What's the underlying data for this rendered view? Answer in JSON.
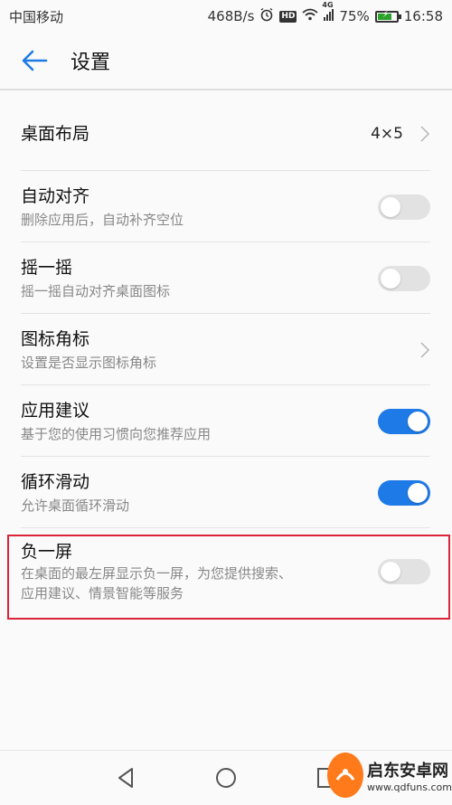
{
  "status_bar": {
    "carrier": "中国移动",
    "net_speed": "468B/s",
    "hd": "HD",
    "network_type": "4G",
    "battery_percent": "75%",
    "battery_level": 0.75,
    "time": "16:58"
  },
  "app_bar": {
    "title": "设置"
  },
  "settings": {
    "desktop_layout": {
      "title": "桌面布局",
      "value": "4×5"
    },
    "auto_align": {
      "title": "自动对齐",
      "subtitle": "删除应用后，自动补齐空位",
      "enabled": false
    },
    "shake": {
      "title": "摇一摇",
      "subtitle": "摇一摇自动对齐桌面图标",
      "enabled": false
    },
    "icon_badge": {
      "title": "图标角标",
      "subtitle": "设置是否显示图标角标"
    },
    "app_suggest": {
      "title": "应用建议",
      "subtitle": "基于您的使用习惯向您推荐应用",
      "enabled": true
    },
    "loop_scroll": {
      "title": "循环滑动",
      "subtitle": "允许桌面循环滑动",
      "enabled": true
    },
    "minus_one_screen": {
      "title": "负一屏",
      "subtitle_line1": "在桌面的最左屏显示负一屏，为您提供搜索、",
      "subtitle_line2": "应用建议、情景智能等服务",
      "enabled": false
    }
  },
  "watermark": {
    "name": "启东安卓网",
    "url": "www.qdfuns.com"
  },
  "colors": {
    "accent": "#1e7ae6",
    "highlight": "#d9243a",
    "toggle_off": "#e2e2e2"
  }
}
